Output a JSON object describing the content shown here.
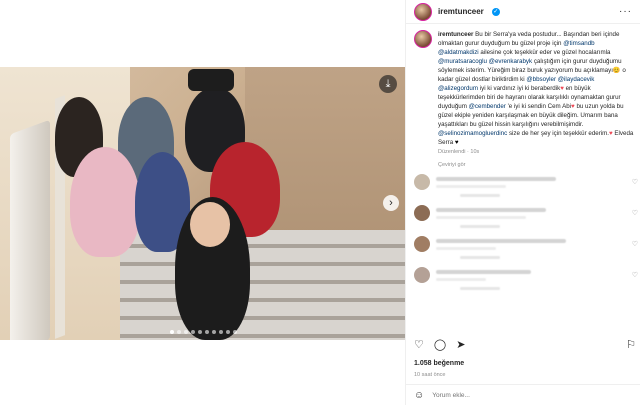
{
  "post": {
    "username": "iremtunceer",
    "caption_parts": [
      {
        "t": "Bu bir Serra'ya veda postudur... Başından beri içinde olmaktan gurur duyduğum bu güzel proje için "
      },
      {
        "m": "@timsandb"
      },
      {
        "t": " "
      },
      {
        "m": "@aldatmakdizi"
      },
      {
        "t": " ailesine çok teşekkür eder ve güzel hocalarımla "
      },
      {
        "m": "@muratsaracoglu"
      },
      {
        "t": " "
      },
      {
        "m": "@evrenkarabyk"
      },
      {
        "t": " çalıştığım için gurur duyduğumu söylemek isterim. Yüreğim biraz buruk yazıyorum bu açıklamayı😊 o kadar güzel dostlar biriktirdim ki "
      },
      {
        "m": "@bbsoyler"
      },
      {
        "t": " "
      },
      {
        "m": "@ilaydacevik"
      },
      {
        "t": " "
      },
      {
        "m": "@alizegordum"
      },
      {
        "t": " iyi ki vardınız iyi ki beraberdik"
      },
      {
        "h": "♥"
      },
      {
        "t": " en büyük teşekkürlerimden biri de hayranı olarak karşılıklı oynamaktan gurur duyduğum "
      },
      {
        "m": "@cembender"
      },
      {
        "t": " 'e iyi ki sendin Cem Abi"
      },
      {
        "h": "♥"
      },
      {
        "t": " bu uzun yolda bu güzel ekiple yeniden karşılaşmak en büyük dileğim. Umarım bana yaşattıkları bu güzel hissin karşılığını verebilmişimdir. "
      },
      {
        "m": "@selinozimamogluerdinc"
      },
      {
        "t": " size de her şey için teşekkür ederim."
      },
      {
        "h": "♥"
      },
      {
        "t": " Elveda Serra "
      },
      {
        "b": "♥"
      }
    ],
    "caption_meta": "Düzenlendi · 10s",
    "see_translation": "Çeviriyi gör",
    "likes": "1.058 beğenme",
    "time_ago": "10 saat önce",
    "comment_placeholder": "Yorum ekle..."
  },
  "icons": {
    "more": "more-icon",
    "download": "download-icon",
    "next": "chevron-right-icon",
    "like": "heart-icon",
    "comment": "comment-icon",
    "share": "share-icon",
    "save": "bookmark-icon",
    "emoji": "emoji-icon"
  },
  "colors": {
    "mention": "#00376b",
    "heart": "#ed4956",
    "verified": "#0095f6"
  },
  "comments": [
    {
      "avatar_color": "#c7b9a8"
    },
    {
      "avatar_color": "#8c6c55"
    },
    {
      "avatar_color": "#a07d63"
    },
    {
      "avatar_color": "#b4a196"
    }
  ],
  "carousel": {
    "count": 10,
    "active": 0
  }
}
